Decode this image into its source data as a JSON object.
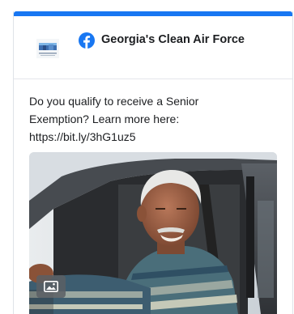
{
  "post": {
    "page_name": "Georgia's Clean Air Force",
    "text_lines": [
      "Do you qualify to receive a Senior",
      "Exemption? Learn more here:",
      "https://bit.ly/3hG1uz5"
    ]
  },
  "colors": {
    "accent": "#1877f2",
    "text": "#1c1e21",
    "divider": "#e4e6eb"
  },
  "icons": {
    "brand": "facebook-icon",
    "media": "image-icon",
    "logo": "page-logo"
  }
}
